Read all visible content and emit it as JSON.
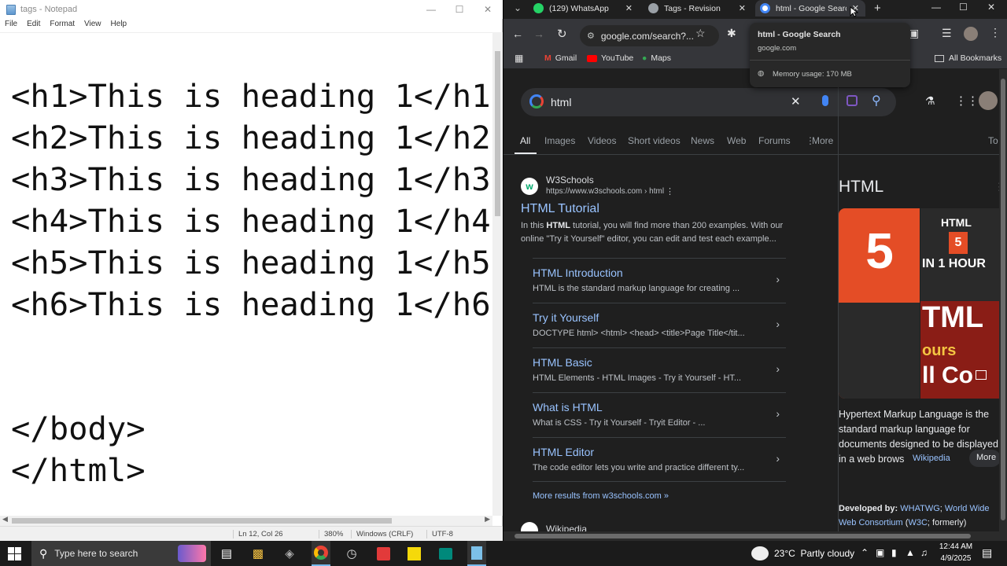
{
  "notepad": {
    "title": "tags - Notepad",
    "menu": [
      "File",
      "Edit",
      "Format",
      "View",
      "Help"
    ],
    "lines": [
      "<h1>This is heading 1</h1",
      "<h2>This is heading 1</h2",
      "<h3>This is heading 1</h3",
      "<h4>This is heading 1</h4",
      "<h5>This is heading 1</h5",
      "<h6>This is heading 1</h6",
      "</body>",
      "</html>"
    ],
    "status": {
      "position": "Ln 12, Col 26",
      "zoom": "380%",
      "line_ending": "Windows (CRLF)",
      "encoding": "UTF-8"
    }
  },
  "browser": {
    "tabs": [
      {
        "label": "(129) WhatsApp",
        "color": "#25d366"
      },
      {
        "label": "Tags - Revision",
        "color": "#9aa0a6"
      },
      {
        "label": "html - Google Search",
        "color": "#ffffff"
      }
    ],
    "address": "google.com/search?...",
    "bookmarks": [
      "Gmail",
      "YouTube",
      "Maps"
    ],
    "all_bookmarks": "All Bookmarks",
    "tooltip": {
      "title": "html - Google Search",
      "url": "google.com",
      "memory": "Memory usage: 170 MB"
    },
    "search_query": "html",
    "nav_tabs": [
      "All",
      "Images",
      "Videos",
      "Short videos",
      "News",
      "Web",
      "Forums",
      "More",
      "To"
    ],
    "result": {
      "site": "W3Schools",
      "url": "https://www.w3schools.com › html",
      "title": "HTML Tutorial",
      "snippet1_pre": "In this ",
      "snippet1_bold": "HTML",
      "snippet1_post": " tutorial, you will find more than 200 examples. With our",
      "snippet2": "online \"Try it Yourself\" editor, you can edit and test each example...",
      "sitelinks": [
        {
          "title": "HTML Introduction",
          "desc": "HTML is the standard markup language for creating ..."
        },
        {
          "title": "Try it Yourself",
          "desc": "DOCTYPE html> <html> <head> <title>Page Title</tit..."
        },
        {
          "title": "HTML Basic",
          "desc": "HTML Elements - HTML Images - Try it Yourself - HT..."
        },
        {
          "title": "What is HTML",
          "desc": "What is CSS - Try it Yourself - Tryit Editor - ..."
        },
        {
          "title": "HTML Editor",
          "desc": "The code editor lets you write and practice different ty..."
        }
      ],
      "more_results": "More results from w3schools.com »",
      "next_site": "Wikipedia"
    },
    "knowledge": {
      "title": "HTML",
      "thumb_text1": "HTML",
      "thumb_text2": "IN 1 HOUR",
      "thumb_text3": "TML",
      "thumb_text4": "ours",
      "thumb_text5": "ll Co",
      "desc_lines": [
        "Hypertext Markup Language is the",
        "standard markup language for",
        "documents designed to be displayed",
        "in a web brows"
      ],
      "wiki": "Wikipedia",
      "more": "More",
      "developed_by_label": "Developed by:",
      "developed_by_1": "WHATWG",
      "developed_by_2": "World Wide",
      "developed_by_3": "Web Consortium",
      "developed_by_4": "W3C",
      "developed_by_5": "formerly"
    }
  },
  "taskbar": {
    "search_placeholder": "Type here to search",
    "weather": "23°C  Partly cloudy",
    "time": "12:44 AM",
    "date": "4/9/2025"
  }
}
